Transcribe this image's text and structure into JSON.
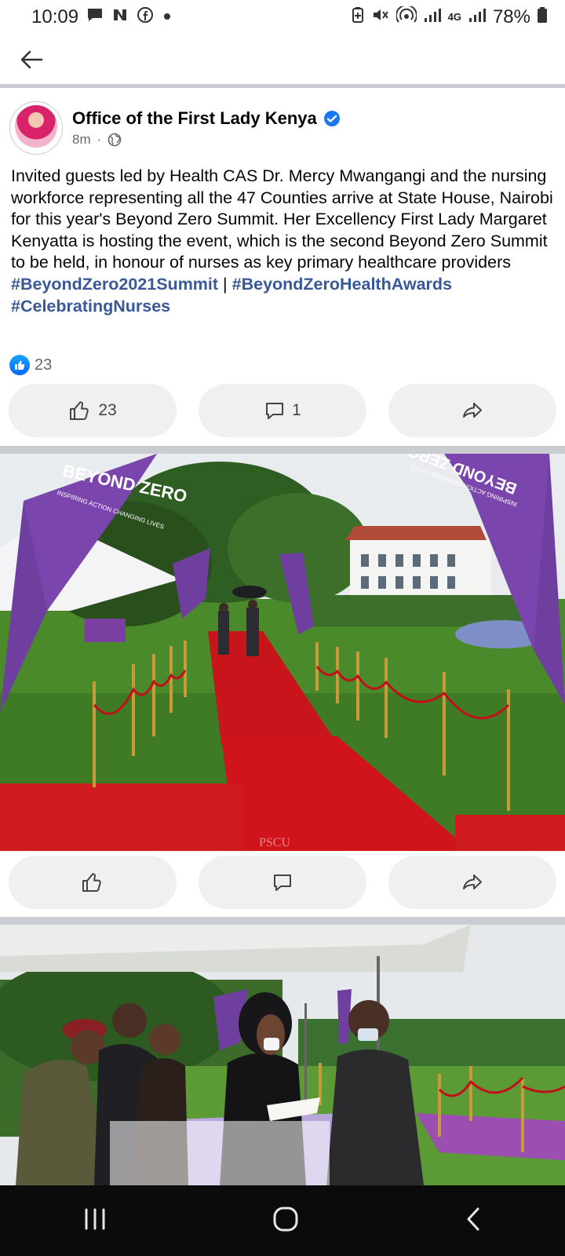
{
  "status_bar": {
    "time": "10:09",
    "left_icons": [
      "chat-icon",
      "news-icon",
      "facebook-icon",
      "dot-icon"
    ],
    "right_icons": [
      "battery-saver-icon",
      "mute-icon",
      "hotspot-icon",
      "signal-icon",
      "4g-icon",
      "signal-icon"
    ],
    "network": "4G",
    "battery": "78%"
  },
  "top_bar": {
    "back_icon": "arrow-left-icon"
  },
  "post": {
    "page_name": "Office of the First Lady Kenya",
    "time_ago": "8m",
    "separator": "·",
    "audience_icon": "globe-icon",
    "text": "Invited guests led by Health CAS Dr. Mercy Mwangangi and the nursing workforce representing all the 47 Counties arrive at State House, Nairobi for this year's Beyond Zero Summit. Her Excellency First Lady Margaret Kenyatta is hosting the event, which is the second Beyond Zero Summit to be held, in honour of nurses as key primary healthcare providers",
    "hashtags": [
      "#BeyondZero2021Summit",
      "#BeyondZeroHealthAwards",
      "#CelebratingNurses"
    ],
    "hashtag_divider": "|",
    "reaction_count": "23",
    "actions": {
      "like_count": "23",
      "comment_count": "1"
    }
  },
  "photo1": {
    "banner_left": {
      "title": "BEYOND ZERO",
      "tagline": "INSPIRING ACTION CHANGING LIVES"
    },
    "banner_right": {
      "title": "BEYOND ZERO",
      "tagline": "INSPIRING ACTION CHANGING LIVES"
    },
    "watermark": "PSCU"
  },
  "colors": {
    "accent_blue": "#1877f2",
    "hashtag": "#385898",
    "button_bg": "#eff0f2",
    "separator": "#c9ccd1",
    "banner_purple": "#6f3fa0",
    "carpet_red": "#d0141b"
  }
}
